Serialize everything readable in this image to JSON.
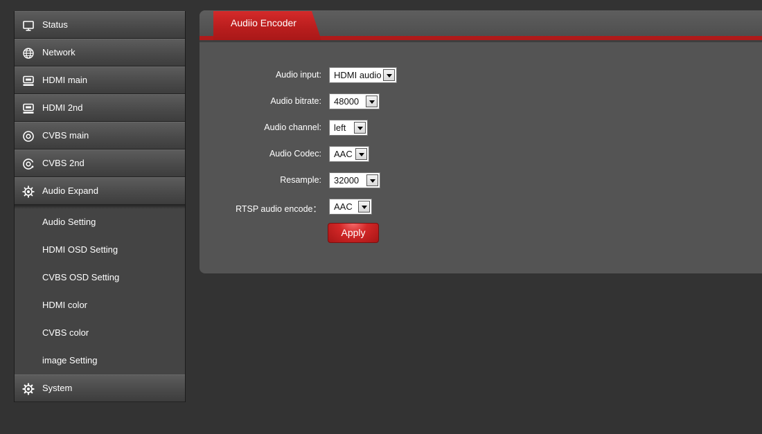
{
  "sidebar": {
    "items": [
      {
        "label": "Status",
        "icon": "monitor-icon"
      },
      {
        "label": "Network",
        "icon": "globe-icon"
      },
      {
        "label": "HDMI main",
        "icon": "hdmi-icon"
      },
      {
        "label": "HDMI 2nd",
        "icon": "hdmi-icon"
      },
      {
        "label": "CVBS main",
        "icon": "cvbs-icon"
      },
      {
        "label": "CVBS 2nd",
        "icon": "cvbs-icon"
      },
      {
        "label": "Audio Expand",
        "icon": "gear-icon"
      }
    ],
    "subitems": [
      {
        "label": "Audio Setting"
      },
      {
        "label": "HDMI OSD Setting"
      },
      {
        "label": "CVBS OSD Setting"
      },
      {
        "label": "HDMI color"
      },
      {
        "label": "CVBS color"
      },
      {
        "label": "image Setting"
      }
    ],
    "system": {
      "label": "System",
      "icon": "gear-icon"
    }
  },
  "panel": {
    "tab_label": "Audiio Encoder",
    "accent_color": "#b01a1a",
    "fields": [
      {
        "label": "Audio input:",
        "value": "HDMI audio"
      },
      {
        "label": "Audio bitrate:",
        "value": "48000"
      },
      {
        "label": "Audio channel:",
        "value": "left"
      },
      {
        "label": "Audio Codec:",
        "value": "AAC"
      },
      {
        "label": "Resample:",
        "value": "32000"
      },
      {
        "label": "RTSP audio encode：",
        "value": "AAC"
      }
    ],
    "apply_label": "Apply"
  }
}
